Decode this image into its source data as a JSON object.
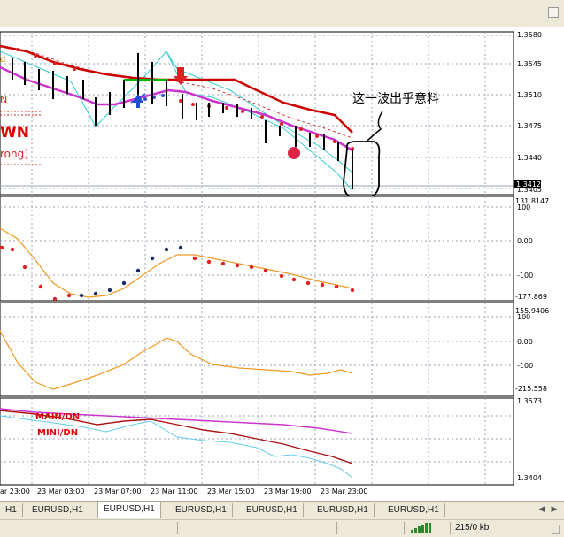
{
  "window": {
    "title": ""
  },
  "main_chart": {
    "price_labels": [
      "1.3580",
      "1.3545",
      "1.3510",
      "1.3475",
      "1.3440",
      "1.3405"
    ],
    "current_price": "1.3412",
    "legend_fragments": {
      "top": "d",
      "left_n": "N",
      "down": "WN",
      "strong": "rong]"
    },
    "annotation": "这一波出乎意料",
    "colors": {
      "ma_red": "#cc0000",
      "ma_magenta": "#cc33cc",
      "channel": "#33cccc",
      "green": "#00bb00",
      "up_arrow": "#1f4fcf",
      "down_arrow": "#dd2222"
    }
  },
  "cci_panel": {
    "labels": [
      "131.8147",
      "0.00",
      "-100",
      "-177.869"
    ],
    "plus100": "100"
  },
  "osc_panel": {
    "labels": [
      "155.9406",
      "100",
      "0.00",
      "-100",
      "-215.558"
    ]
  },
  "ma_panel": {
    "labels": [
      "1.3573",
      "1.3404"
    ],
    "legend_main": "MAIN/DN",
    "legend_mini": "MINI/DN"
  },
  "time_axis": [
    "ar 23:00",
    "23 Mar 03:00",
    "23 Mar 07:00",
    "23 Mar 11:00",
    "23 Mar 15:00",
    "23 Mar 19:00",
    "23 Mar 23:00"
  ],
  "tabs": [
    {
      "label": "H1",
      "active": false
    },
    {
      "label": "EURUSD,H1",
      "active": false
    },
    {
      "label": "EURUSD,H1",
      "active": true
    },
    {
      "label": "EURUSD,H1",
      "active": false
    },
    {
      "label": "EURUSD,H1",
      "active": false
    },
    {
      "label": "EURUSD,H1",
      "active": false
    },
    {
      "label": "EURUSD,H1",
      "active": false
    }
  ],
  "status": {
    "traffic": "215/0 kb"
  }
}
